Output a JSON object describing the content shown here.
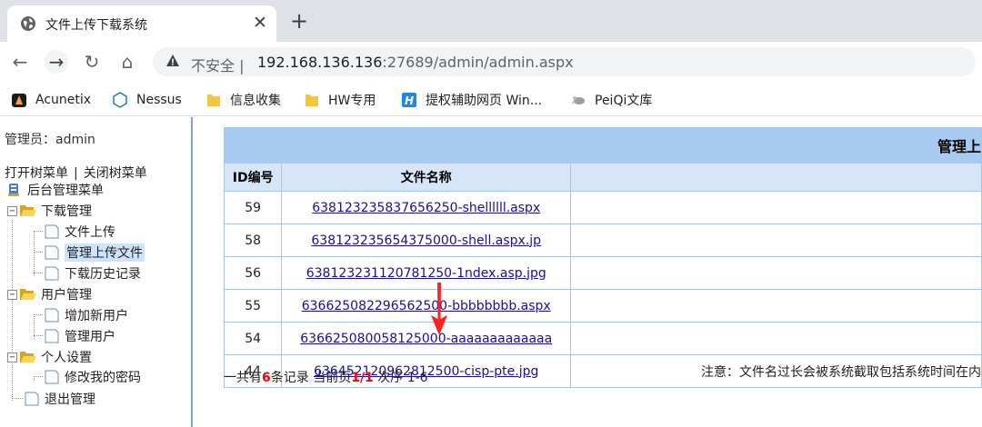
{
  "browser": {
    "tab": {
      "title": "文件上传下载系统",
      "close_glyph": "✕"
    },
    "new_tab_glyph": "+",
    "nav": {
      "back": "←",
      "forward": "→",
      "reload": "↻",
      "home": "⌂"
    },
    "address": {
      "security_label": "不安全",
      "separator": "|",
      "host": "192.168.136.136",
      "port_path": ":27689/admin/admin.aspx"
    },
    "bookmarks": [
      {
        "label": "Acunetix",
        "icon": "acunetix-icon"
      },
      {
        "label": "Nessus",
        "icon": "nessus-icon"
      },
      {
        "label": "信息收集",
        "icon": "folder-icon"
      },
      {
        "label": "HW专用",
        "icon": "folder-icon"
      },
      {
        "label": "提权辅助网页 Win...",
        "icon": "h-logo-icon"
      },
      {
        "label": "PeiQi文库",
        "icon": "peiqi-icon"
      }
    ]
  },
  "sidebar": {
    "admin_label": "管理员：admin",
    "open_tree": "打开树菜单",
    "separator": "|",
    "close_tree": "关闭树菜单",
    "root": "后台管理菜单",
    "groups": [
      {
        "label": "下载管理",
        "items": [
          "文件上传",
          "管理上传文件",
          "下载历史记录"
        ]
      },
      {
        "label": "用户管理",
        "items": [
          "增加新用户",
          "管理用户"
        ]
      },
      {
        "label": "个人设置",
        "items": [
          "修改我的密码"
        ]
      }
    ],
    "logout": "退出管理",
    "selected_item": "管理上传文件"
  },
  "table": {
    "title": "管理上",
    "headers": [
      "ID编号",
      "文件名称",
      ""
    ],
    "rows": [
      {
        "id": "59",
        "name": "638123235837656250-shellllll.aspx",
        "note": ""
      },
      {
        "id": "58",
        "name": "638123235654375000-shell.aspx.jp",
        "note": ""
      },
      {
        "id": "56",
        "name": "638123231120781250-1ndex.asp.jpg",
        "note": ""
      },
      {
        "id": "55",
        "name": "636625082296562500-bbbbbbbb.aspx",
        "note": ""
      },
      {
        "id": "54",
        "name": "636625080058125000-aaaaaaaaaaaaa",
        "note": ""
      },
      {
        "id": "44",
        "name": "636452120962812500-cisp-pte.jpg",
        "note": "注意：文件名过长会被系统截取包括系统时间在内"
      }
    ]
  },
  "summary": {
    "prefix": "一共有",
    "count": "6",
    "records_label": "条记录 当前页",
    "page": "1/1",
    "order_label": " 次序 1-6"
  },
  "colors": {
    "accent_red": "#ff0000",
    "table_header": "#a9cbf1",
    "column_header": "#d6e6f8",
    "link": "#1a0dab",
    "frame_border": "#7fa7d6"
  }
}
